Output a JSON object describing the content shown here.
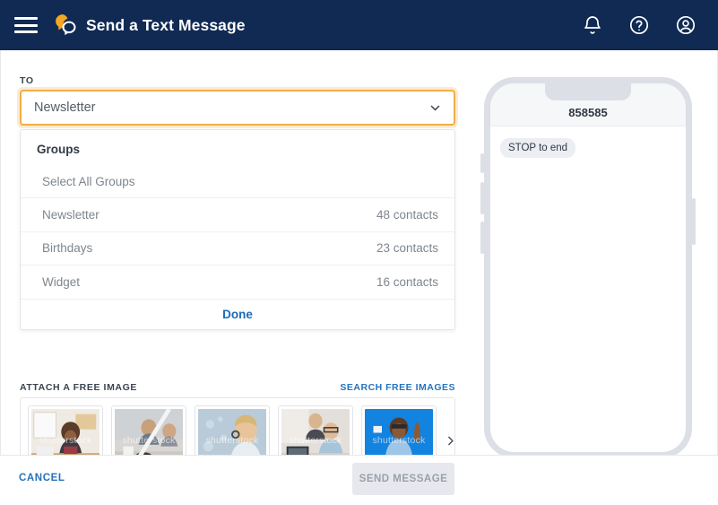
{
  "header": {
    "menu_icon": "hamburger-menu-icon",
    "logo_icon": "brand-logo-icon",
    "title": "Send a Text Message",
    "actions": [
      {
        "icon": "bell-icon",
        "name": "notifications-button"
      },
      {
        "icon": "question-mark-circle-icon",
        "name": "help-button"
      },
      {
        "icon": "user-circle-icon",
        "name": "account-button"
      }
    ]
  },
  "recipient": {
    "label": "TO",
    "selected_value": "Newsletter",
    "chevron_icon": "chevron-down-icon",
    "focus_color": "#f2ad45"
  },
  "dropdown": {
    "title": "Groups",
    "select_all_label": "Select All Groups",
    "groups": [
      {
        "name": "Newsletter",
        "count": "48 contacts"
      },
      {
        "name": "Birthdays",
        "count": "23 contacts"
      },
      {
        "name": "Widget",
        "count": "16 contacts"
      }
    ],
    "done_label": "Done",
    "done_color": "#1b6cb5"
  },
  "attach": {
    "label": "ATTACH A FREE IMAGE",
    "search_link": "SEARCH FREE IMAGES",
    "link_color": "#2673bc",
    "next_icon": "chevron-right-icon",
    "thumbnails": [
      {
        "name": "woman-at-desk-with-laptop",
        "watermark": "shutterstock"
      },
      {
        "name": "men-in-cafe-meeting",
        "watermark": "shutterstock"
      },
      {
        "name": "woman-with-headset-support",
        "watermark": "shutterstock"
      },
      {
        "name": "two-men-at-computer",
        "watermark": "shutterstock"
      },
      {
        "name": "man-pointing-up-blue-background",
        "watermark": "shutterstock"
      }
    ]
  },
  "footer": {
    "cancel_label": "CANCEL",
    "send_label": "SEND MESSAGE",
    "send_disabled": true
  },
  "preview": {
    "phone_number": "858585",
    "messages": [
      {
        "text": "STOP to end",
        "side": "incoming"
      }
    ]
  },
  "colors": {
    "topbar": "#102a54",
    "accent_orange": "#f2ad45",
    "link_blue": "#2673bc",
    "bubble": "#eceef4"
  }
}
